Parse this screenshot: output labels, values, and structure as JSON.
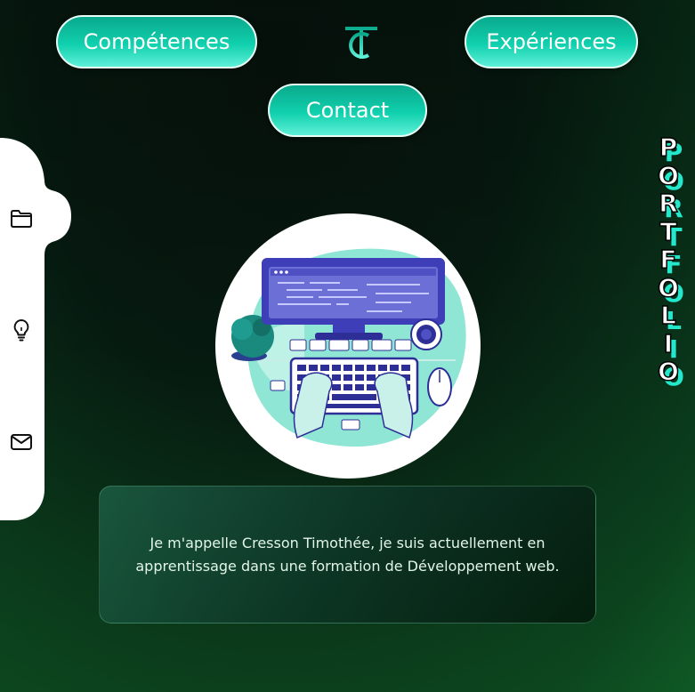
{
  "nav": {
    "competences_label": "Compétences",
    "experiences_label": "Expériences",
    "contact_label": "Contact",
    "logo_text": "TC"
  },
  "sidebar": {
    "items": [
      {
        "name": "folder-icon"
      },
      {
        "name": "lightbulb-icon"
      },
      {
        "name": "mail-icon"
      }
    ]
  },
  "portfolio": {
    "letters": [
      "P",
      "O",
      "R",
      "T",
      "F",
      "O",
      "L",
      "I",
      "O"
    ]
  },
  "intro": {
    "text": "Je m'appelle Cresson Timothée, je suis actuellement en apprentissage dans une formation de Développement web."
  },
  "colors": {
    "accent": "#10d0ad",
    "accent_light": "#5ff0d8",
    "background_dark": "#061a10",
    "background_green": "#0d5224",
    "portfolio_shadow": "#23e8cc"
  }
}
